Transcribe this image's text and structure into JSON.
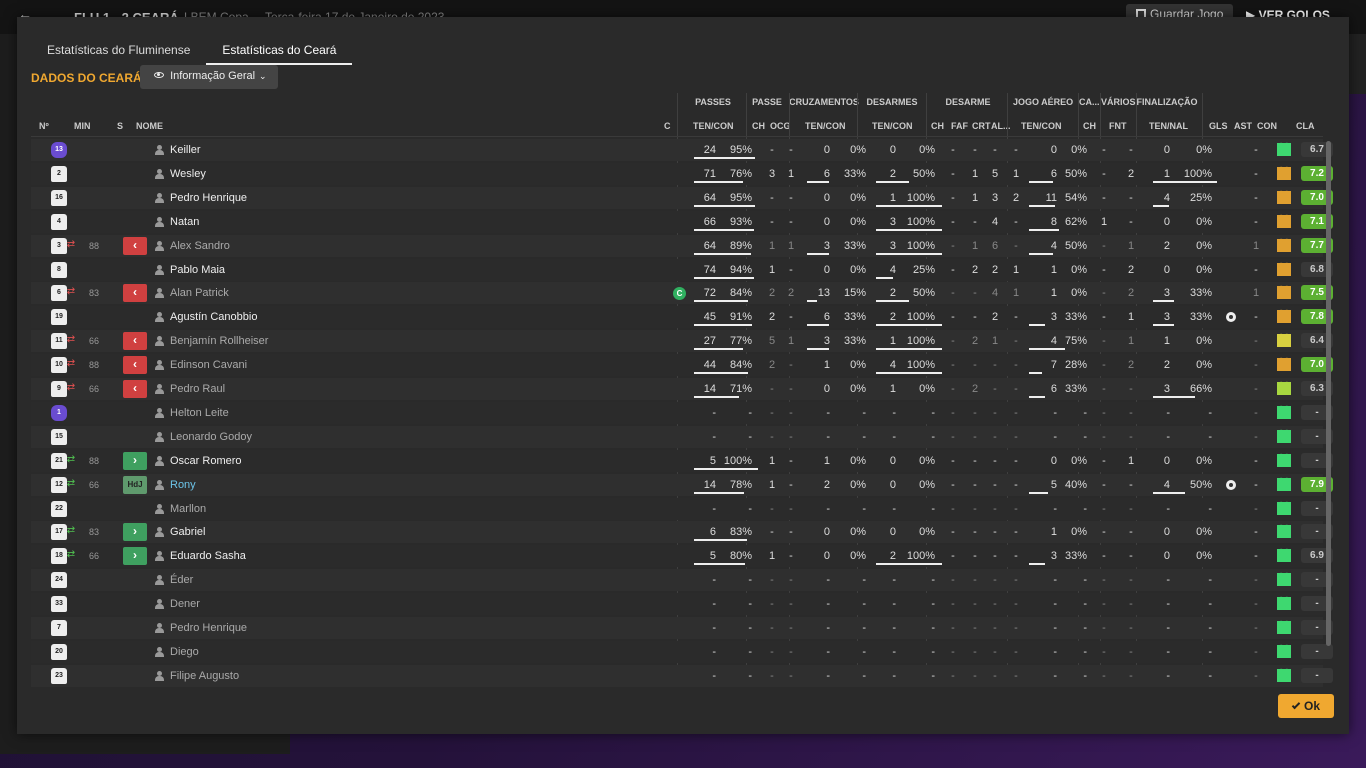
{
  "topbar": {
    "match": "FLU 1 - 2 CEARÁ",
    "competition": "LBEM Copa",
    "date": "Terça-feira 17 de Janeiro de 2023",
    "save_label": "Guardar Jogo",
    "play_label": "VER GOLOS"
  },
  "modal": {
    "tabs": [
      {
        "label": "Estatísticas do Fluminense",
        "active": false
      },
      {
        "label": "Estatísticas do Ceará",
        "active": true
      }
    ],
    "section_title": "DADOS DO CEARÁ",
    "view_label": "Informação Geral",
    "ok_label": "Ok"
  },
  "groups": {
    "passes": "PASSES",
    "passe": "PASSE",
    "cruzamentos": "CRUZAMENTOS",
    "desarmes": "DESARMES",
    "desarme": "DESARME",
    "jogo_aereo": "JOGO AÉREO",
    "ca": "CA...",
    "varios": "VÁRIOS",
    "finalizacao": "FINALIZAÇÃO"
  },
  "columns": {
    "num": "Nº",
    "min": "MIN",
    "s": "S",
    "name": "NOME",
    "c": "C",
    "pas_tc": "TEN/CON",
    "ch": "CH",
    "ocg": "OCG",
    "cru_tc": "TEN/CON",
    "des_tc": "TEN/CON",
    "dch": "CH",
    "faf": "FAF",
    "crt": "CRT",
    "al": "AL...",
    "aer_tc": "TEN/CON",
    "cach": "CH",
    "fnt": "FNT",
    "fin_tn": "TEN/NAL",
    "gls": "GLS",
    "ast": "AST",
    "con": "CON",
    "cla": "CLA"
  },
  "colors": {
    "accent": "#f0a830",
    "rating_good": "#5cb032",
    "heart_green": "#3ed870",
    "heart_orange": "#e0a030",
    "heart_yellow": "#d8d040",
    "heart_lime": "#a8d840",
    "sub_out": "#d04040",
    "sub_in": "#3fa060"
  },
  "players": [
    {
      "num": "13",
      "gk": true,
      "sub": "",
      "min": "",
      "badge": "",
      "name": "Keiller",
      "dim": false,
      "hl": false,
      "cap": false,
      "pt": "24",
      "pc": "95%",
      "pb": 0.95,
      "ch": "-",
      "ocg": "-",
      "crt": "0",
      "crc": "0%",
      "crb": 0,
      "dt": "0",
      "dc": "0%",
      "db": 0,
      "dch": "-",
      "faf": "-",
      "dcr": "-",
      "al": "-",
      "at": "0",
      "ac": "0%",
      "ab": 0,
      "cach": "-",
      "fnt": "-",
      "ft": "0",
      "fc": "0%",
      "fb": 0,
      "gls": "",
      "ball": false,
      "ast": "-",
      "heart": "green",
      "cla": "6.7",
      "good": false
    },
    {
      "num": "2",
      "gk": false,
      "sub": "",
      "min": "",
      "badge": "",
      "name": "Wesley",
      "dim": false,
      "hl": false,
      "cap": false,
      "pt": "71",
      "pc": "76%",
      "pb": 0.76,
      "ch": "3",
      "ocg": "1",
      "crt": "6",
      "crc": "33%",
      "crb": 0.33,
      "dt": "2",
      "dc": "50%",
      "db": 0.5,
      "dch": "-",
      "faf": "1",
      "dcr": "5",
      "al": "1",
      "at": "6",
      "ac": "50%",
      "ab": 0.5,
      "cach": "-",
      "fnt": "2",
      "ft": "1",
      "fc": "100%",
      "fb": 1,
      "gls": "",
      "ball": false,
      "ast": "-",
      "heart": "orange",
      "cla": "7.2",
      "good": true
    },
    {
      "num": "16",
      "gk": false,
      "sub": "",
      "min": "",
      "badge": "",
      "name": "Pedro Henrique",
      "dim": false,
      "hl": false,
      "cap": false,
      "pt": "64",
      "pc": "95%",
      "pb": 0.95,
      "ch": "-",
      "ocg": "-",
      "crt": "0",
      "crc": "0%",
      "crb": 0,
      "dt": "1",
      "dc": "100%",
      "db": 1,
      "dch": "-",
      "faf": "1",
      "dcr": "3",
      "al": "2",
      "at": "11",
      "ac": "54%",
      "ab": 0.54,
      "cach": "-",
      "fnt": "-",
      "ft": "4",
      "fc": "25%",
      "fb": 0.25,
      "gls": "",
      "ball": false,
      "ast": "-",
      "heart": "orange",
      "cla": "7.0",
      "good": true
    },
    {
      "num": "4",
      "gk": false,
      "sub": "",
      "min": "",
      "badge": "",
      "name": "Natan",
      "dim": false,
      "hl": false,
      "cap": false,
      "pt": "66",
      "pc": "93%",
      "pb": 0.93,
      "ch": "-",
      "ocg": "-",
      "crt": "0",
      "crc": "0%",
      "crb": 0,
      "dt": "3",
      "dc": "100%",
      "db": 1,
      "dch": "-",
      "faf": "-",
      "dcr": "4",
      "al": "-",
      "at": "8",
      "ac": "62%",
      "ab": 0.62,
      "cach": "1",
      "fnt": "-",
      "ft": "0",
      "fc": "0%",
      "fb": 0,
      "gls": "",
      "ball": false,
      "ast": "-",
      "heart": "orange",
      "cla": "7.1",
      "good": true
    },
    {
      "num": "3",
      "gk": false,
      "sub": "out",
      "min": "88",
      "badge": "out",
      "name": "Alex Sandro",
      "dim": true,
      "hl": false,
      "cap": false,
      "pt": "64",
      "pc": "89%",
      "pb": 0.89,
      "ch": "1",
      "ocg": "1",
      "crt": "3",
      "crc": "33%",
      "crb": 0.33,
      "dt": "3",
      "dc": "100%",
      "db": 1,
      "dch": "-",
      "faf": "1",
      "dcr": "6",
      "al": "-",
      "at": "4",
      "ac": "50%",
      "ab": 0.5,
      "cach": "-",
      "fnt": "1",
      "ft": "2",
      "fc": "0%",
      "fb": 0,
      "gls": "",
      "ball": false,
      "ast": "1",
      "heart": "orange",
      "cla": "7.7",
      "good": true
    },
    {
      "num": "8",
      "gk": false,
      "sub": "",
      "min": "",
      "badge": "",
      "name": "Pablo Maia",
      "dim": false,
      "hl": false,
      "cap": false,
      "pt": "74",
      "pc": "94%",
      "pb": 0.94,
      "ch": "1",
      "ocg": "-",
      "crt": "0",
      "crc": "0%",
      "crb": 0,
      "dt": "4",
      "dc": "25%",
      "db": 0.25,
      "dch": "-",
      "faf": "2",
      "dcr": "2",
      "al": "1",
      "at": "1",
      "ac": "0%",
      "ab": 0,
      "cach": "-",
      "fnt": "2",
      "ft": "0",
      "fc": "0%",
      "fb": 0,
      "gls": "",
      "ball": false,
      "ast": "-",
      "heart": "orange",
      "cla": "6.8",
      "good": false
    },
    {
      "num": "6",
      "gk": false,
      "sub": "out",
      "min": "83",
      "badge": "out",
      "name": "Alan Patrick",
      "dim": true,
      "hl": false,
      "cap": true,
      "pt": "72",
      "pc": "84%",
      "pb": 0.84,
      "ch": "2",
      "ocg": "2",
      "crt": "13",
      "crc": "15%",
      "crb": 0.15,
      "dt": "2",
      "dc": "50%",
      "db": 0.5,
      "dch": "-",
      "faf": "-",
      "dcr": "4",
      "al": "1",
      "at": "1",
      "ac": "0%",
      "ab": 0,
      "cach": "-",
      "fnt": "2",
      "ft": "3",
      "fc": "33%",
      "fb": 0.33,
      "gls": "",
      "ball": false,
      "ast": "1",
      "heart": "orange",
      "cla": "7.5",
      "good": true
    },
    {
      "num": "19",
      "gk": false,
      "sub": "",
      "min": "",
      "badge": "",
      "name": "Agustín Canobbio",
      "dim": false,
      "hl": false,
      "cap": false,
      "pt": "45",
      "pc": "91%",
      "pb": 0.91,
      "ch": "2",
      "ocg": "-",
      "crt": "6",
      "crc": "33%",
      "crb": 0.33,
      "dt": "2",
      "dc": "100%",
      "db": 1,
      "dch": "-",
      "faf": "-",
      "dcr": "2",
      "al": "-",
      "at": "3",
      "ac": "33%",
      "ab": 0.33,
      "cach": "-",
      "fnt": "1",
      "ft": "3",
      "fc": "33%",
      "fb": 0.33,
      "gls": "",
      "ball": true,
      "ast": "-",
      "heart": "orange",
      "cla": "7.8",
      "good": true
    },
    {
      "num": "11",
      "gk": false,
      "sub": "out",
      "min": "66",
      "badge": "out",
      "name": "Benjamín Rollheiser",
      "dim": true,
      "hl": false,
      "cap": false,
      "pt": "27",
      "pc": "77%",
      "pb": 0.77,
      "ch": "5",
      "ocg": "1",
      "crt": "3",
      "crc": "33%",
      "crb": 0.33,
      "dt": "1",
      "dc": "100%",
      "db": 1,
      "dch": "-",
      "faf": "2",
      "dcr": "1",
      "al": "-",
      "at": "4",
      "ac": "75%",
      "ab": 0.75,
      "cach": "-",
      "fnt": "1",
      "ft": "1",
      "fc": "0%",
      "fb": 0,
      "gls": "",
      "ball": false,
      "ast": "-",
      "heart": "yellow",
      "cla": "6.4",
      "good": false
    },
    {
      "num": "10",
      "gk": false,
      "sub": "out",
      "min": "88",
      "badge": "out",
      "name": "Edinson Cavani",
      "dim": true,
      "hl": false,
      "cap": false,
      "pt": "44",
      "pc": "84%",
      "pb": 0.84,
      "ch": "2",
      "ocg": "-",
      "crt": "1",
      "crc": "0%",
      "crb": 0,
      "dt": "4",
      "dc": "100%",
      "db": 1,
      "dch": "-",
      "faf": "-",
      "dcr": "-",
      "al": "-",
      "at": "7",
      "ac": "28%",
      "ab": 0.28,
      "cach": "-",
      "fnt": "2",
      "ft": "2",
      "fc": "0%",
      "fb": 0,
      "gls": "",
      "ball": false,
      "ast": "-",
      "heart": "orange",
      "cla": "7.0",
      "good": true
    },
    {
      "num": "9",
      "gk": false,
      "sub": "out",
      "min": "66",
      "badge": "out",
      "name": "Pedro Raul",
      "dim": true,
      "hl": false,
      "cap": false,
      "pt": "14",
      "pc": "71%",
      "pb": 0.71,
      "ch": "-",
      "ocg": "-",
      "crt": "0",
      "crc": "0%",
      "crb": 0,
      "dt": "1",
      "dc": "0%",
      "db": 0,
      "dch": "-",
      "faf": "2",
      "dcr": "-",
      "al": "-",
      "at": "6",
      "ac": "33%",
      "ab": 0.33,
      "cach": "-",
      "fnt": "-",
      "ft": "3",
      "fc": "66%",
      "fb": 0.66,
      "gls": "",
      "ball": false,
      "ast": "-",
      "heart": "lime",
      "cla": "6.3",
      "good": false
    },
    {
      "num": "1",
      "gk": true,
      "sub": "",
      "min": "",
      "badge": "",
      "name": "Helton Leite",
      "dim": true,
      "hl": false,
      "cap": false,
      "pt": "-",
      "pc": "-",
      "pb": 0,
      "ch": "-",
      "ocg": "-",
      "crt": "-",
      "crc": "-",
      "crb": 0,
      "dt": "-",
      "dc": "-",
      "db": 0,
      "dch": "-",
      "faf": "-",
      "dcr": "-",
      "al": "-",
      "at": "-",
      "ac": "-",
      "ab": 0,
      "cach": "-",
      "fnt": "-",
      "ft": "-",
      "fc": "-",
      "fb": 0,
      "gls": "",
      "ball": false,
      "ast": "-",
      "heart": "green",
      "cla": "-",
      "good": false
    },
    {
      "num": "15",
      "gk": false,
      "sub": "",
      "min": "",
      "badge": "",
      "name": "Leonardo Godoy",
      "dim": true,
      "hl": false,
      "cap": false,
      "pt": "-",
      "pc": "-",
      "pb": 0,
      "ch": "-",
      "ocg": "-",
      "crt": "-",
      "crc": "-",
      "crb": 0,
      "dt": "-",
      "dc": "-",
      "db": 0,
      "dch": "-",
      "faf": "-",
      "dcr": "-",
      "al": "-",
      "at": "-",
      "ac": "-",
      "ab": 0,
      "cach": "-",
      "fnt": "-",
      "ft": "-",
      "fc": "-",
      "fb": 0,
      "gls": "",
      "ball": false,
      "ast": "-",
      "heart": "green",
      "cla": "-",
      "good": false
    },
    {
      "num": "21",
      "gk": false,
      "sub": "in",
      "min": "88",
      "badge": "in",
      "name": "Oscar Romero",
      "dim": false,
      "hl": false,
      "cap": false,
      "pt": "5",
      "pc": "100%",
      "pb": 1,
      "ch": "1",
      "ocg": "-",
      "crt": "1",
      "crc": "0%",
      "crb": 0,
      "dt": "0",
      "dc": "0%",
      "db": 0,
      "dch": "-",
      "faf": "-",
      "dcr": "-",
      "al": "-",
      "at": "0",
      "ac": "0%",
      "ab": 0,
      "cach": "-",
      "fnt": "1",
      "ft": "0",
      "fc": "0%",
      "fb": 0,
      "gls": "",
      "ball": false,
      "ast": "-",
      "heart": "green",
      "cla": "-",
      "good": false
    },
    {
      "num": "12",
      "gk": false,
      "sub": "in",
      "min": "66",
      "badge": "motm",
      "name": "Rony",
      "dim": false,
      "hl": true,
      "cap": false,
      "pt": "14",
      "pc": "78%",
      "pb": 0.78,
      "ch": "1",
      "ocg": "-",
      "crt": "2",
      "crc": "0%",
      "crb": 0,
      "dt": "0",
      "dc": "0%",
      "db": 0,
      "dch": "-",
      "faf": "-",
      "dcr": "-",
      "al": "-",
      "at": "5",
      "ac": "40%",
      "ab": 0.4,
      "cach": "-",
      "fnt": "-",
      "ft": "4",
      "fc": "50%",
      "fb": 0.5,
      "gls": "",
      "ball": true,
      "ast": "-",
      "heart": "green",
      "cla": "7.9",
      "good": true
    },
    {
      "num": "22",
      "gk": false,
      "sub": "",
      "min": "",
      "badge": "",
      "name": "Marllon",
      "dim": true,
      "hl": false,
      "cap": false,
      "pt": "-",
      "pc": "-",
      "pb": 0,
      "ch": "-",
      "ocg": "-",
      "crt": "-",
      "crc": "-",
      "crb": 0,
      "dt": "-",
      "dc": "-",
      "db": 0,
      "dch": "-",
      "faf": "-",
      "dcr": "-",
      "al": "-",
      "at": "-",
      "ac": "-",
      "ab": 0,
      "cach": "-",
      "fnt": "-",
      "ft": "-",
      "fc": "-",
      "fb": 0,
      "gls": "",
      "ball": false,
      "ast": "-",
      "heart": "green",
      "cla": "-",
      "good": false
    },
    {
      "num": "17",
      "gk": false,
      "sub": "in",
      "min": "83",
      "badge": "in",
      "name": "Gabriel",
      "dim": false,
      "hl": false,
      "cap": false,
      "pt": "6",
      "pc": "83%",
      "pb": 0.83,
      "ch": "-",
      "ocg": "-",
      "crt": "0",
      "crc": "0%",
      "crb": 0,
      "dt": "0",
      "dc": "0%",
      "db": 0,
      "dch": "-",
      "faf": "-",
      "dcr": "-",
      "al": "-",
      "at": "1",
      "ac": "0%",
      "ab": 0,
      "cach": "-",
      "fnt": "-",
      "ft": "0",
      "fc": "0%",
      "fb": 0,
      "gls": "",
      "ball": false,
      "ast": "-",
      "heart": "green",
      "cla": "-",
      "good": false
    },
    {
      "num": "18",
      "gk": false,
      "sub": "in",
      "min": "66",
      "badge": "in",
      "name": "Eduardo Sasha",
      "dim": false,
      "hl": false,
      "cap": false,
      "pt": "5",
      "pc": "80%",
      "pb": 0.8,
      "ch": "1",
      "ocg": "-",
      "crt": "0",
      "crc": "0%",
      "crb": 0,
      "dt": "2",
      "dc": "100%",
      "db": 1,
      "dch": "-",
      "faf": "-",
      "dcr": "-",
      "al": "-",
      "at": "3",
      "ac": "33%",
      "ab": 0.33,
      "cach": "-",
      "fnt": "-",
      "ft": "0",
      "fc": "0%",
      "fb": 0,
      "gls": "",
      "ball": false,
      "ast": "-",
      "heart": "green",
      "cla": "6.9",
      "good": false
    },
    {
      "num": "24",
      "gk": false,
      "sub": "",
      "min": "",
      "badge": "",
      "name": "Éder",
      "dim": true,
      "hl": false,
      "cap": false,
      "pt": "-",
      "pc": "-",
      "pb": 0,
      "ch": "-",
      "ocg": "-",
      "crt": "-",
      "crc": "-",
      "crb": 0,
      "dt": "-",
      "dc": "-",
      "db": 0,
      "dch": "-",
      "faf": "-",
      "dcr": "-",
      "al": "-",
      "at": "-",
      "ac": "-",
      "ab": 0,
      "cach": "-",
      "fnt": "-",
      "ft": "-",
      "fc": "-",
      "fb": 0,
      "gls": "",
      "ball": false,
      "ast": "-",
      "heart": "green",
      "cla": "-",
      "good": false
    },
    {
      "num": "33",
      "gk": false,
      "sub": "",
      "min": "",
      "badge": "",
      "name": "Dener",
      "dim": true,
      "hl": false,
      "cap": false,
      "pt": "-",
      "pc": "-",
      "pb": 0,
      "ch": "-",
      "ocg": "-",
      "crt": "-",
      "crc": "-",
      "crb": 0,
      "dt": "-",
      "dc": "-",
      "db": 0,
      "dch": "-",
      "faf": "-",
      "dcr": "-",
      "al": "-",
      "at": "-",
      "ac": "-",
      "ab": 0,
      "cach": "-",
      "fnt": "-",
      "ft": "-",
      "fc": "-",
      "fb": 0,
      "gls": "",
      "ball": false,
      "ast": "-",
      "heart": "green",
      "cla": "-",
      "good": false
    },
    {
      "num": "7",
      "gk": false,
      "sub": "",
      "min": "",
      "badge": "",
      "name": "Pedro Henrique",
      "dim": true,
      "hl": false,
      "cap": false,
      "pt": "-",
      "pc": "-",
      "pb": 0,
      "ch": "-",
      "ocg": "-",
      "crt": "-",
      "crc": "-",
      "crb": 0,
      "dt": "-",
      "dc": "-",
      "db": 0,
      "dch": "-",
      "faf": "-",
      "dcr": "-",
      "al": "-",
      "at": "-",
      "ac": "-",
      "ab": 0,
      "cach": "-",
      "fnt": "-",
      "ft": "-",
      "fc": "-",
      "fb": 0,
      "gls": "",
      "ball": false,
      "ast": "-",
      "heart": "green",
      "cla": "-",
      "good": false
    },
    {
      "num": "20",
      "gk": false,
      "sub": "",
      "min": "",
      "badge": "",
      "name": "Diego",
      "dim": true,
      "hl": false,
      "cap": false,
      "pt": "-",
      "pc": "-",
      "pb": 0,
      "ch": "-",
      "ocg": "-",
      "crt": "-",
      "crc": "-",
      "crb": 0,
      "dt": "-",
      "dc": "-",
      "db": 0,
      "dch": "-",
      "faf": "-",
      "dcr": "-",
      "al": "-",
      "at": "-",
      "ac": "-",
      "ab": 0,
      "cach": "-",
      "fnt": "-",
      "ft": "-",
      "fc": "-",
      "fb": 0,
      "gls": "",
      "ball": false,
      "ast": "-",
      "heart": "green",
      "cla": "-",
      "good": false
    },
    {
      "num": "23",
      "gk": false,
      "sub": "",
      "min": "",
      "badge": "",
      "name": "Filipe Augusto",
      "dim": true,
      "hl": false,
      "cap": false,
      "pt": "-",
      "pc": "-",
      "pb": 0,
      "ch": "-",
      "ocg": "-",
      "crt": "-",
      "crc": "-",
      "crb": 0,
      "dt": "-",
      "dc": "-",
      "db": 0,
      "dch": "-",
      "faf": "-",
      "dcr": "-",
      "al": "-",
      "at": "-",
      "ac": "-",
      "ab": 0,
      "cach": "-",
      "fnt": "-",
      "ft": "-",
      "fc": "-",
      "fb": 0,
      "gls": "",
      "ball": false,
      "ast": "-",
      "heart": "green",
      "cla": "-",
      "good": false
    }
  ]
}
